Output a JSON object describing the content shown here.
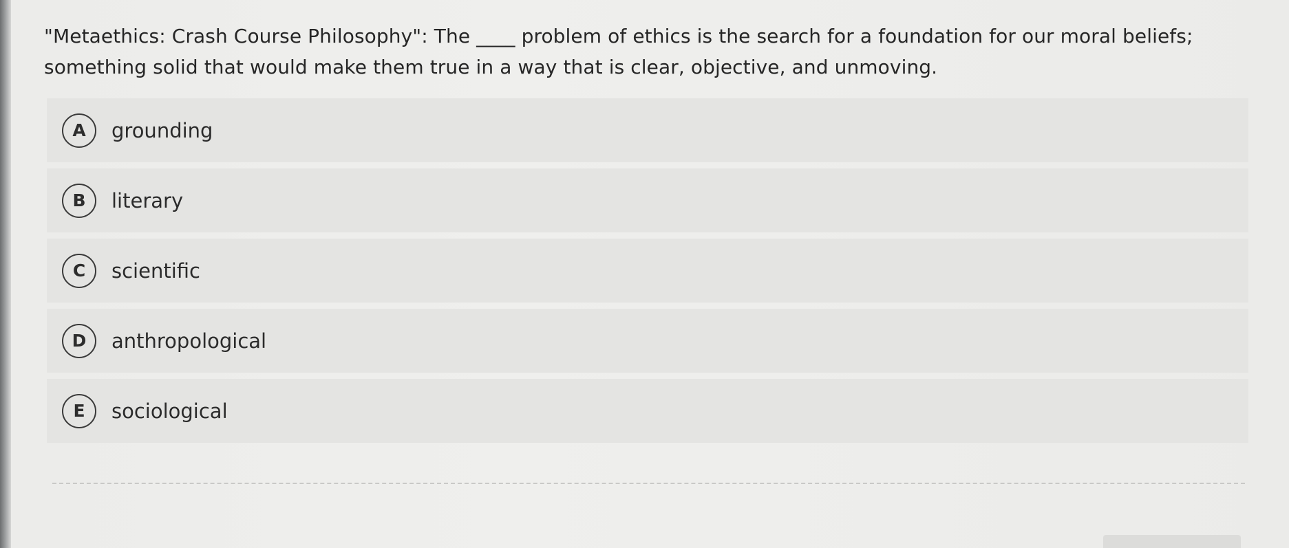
{
  "question": {
    "text": "\"Metaethics: Crash Course Philosophy\": The ____ problem of ethics is the search for a foundation for our moral beliefs; something solid that would make them true in a way that is clear, objective, and unmoving."
  },
  "options": [
    {
      "letter": "A",
      "label": "grounding"
    },
    {
      "letter": "B",
      "label": "literary"
    },
    {
      "letter": "C",
      "label": "scientific"
    },
    {
      "letter": "D",
      "label": "anthropological"
    },
    {
      "letter": "E",
      "label": "sociological"
    }
  ]
}
